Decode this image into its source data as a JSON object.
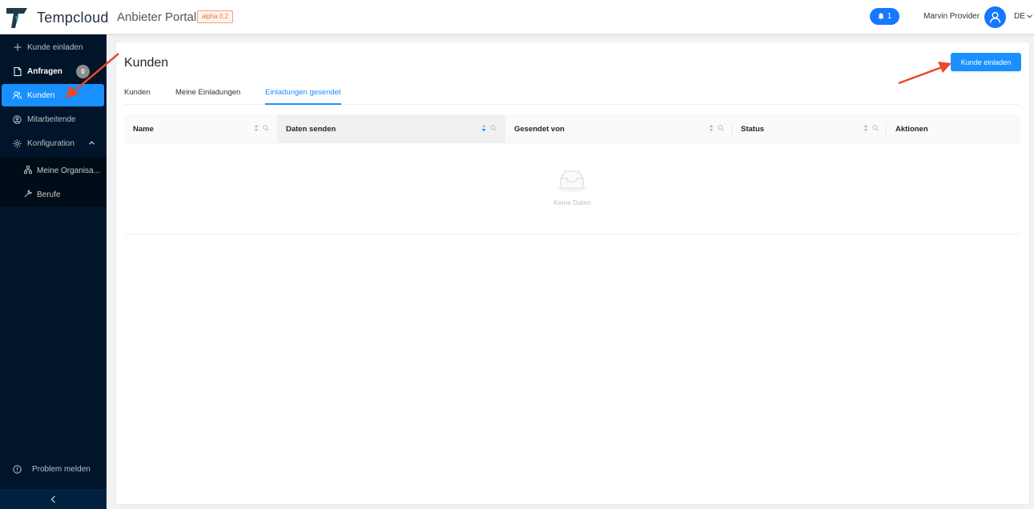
{
  "header": {
    "brand": "Tempcloud",
    "portal": "Anbieter Portal",
    "version_badge": "alpha 0.2",
    "notifications_count": "1",
    "user_name": "Marvin Provider",
    "language": "DE",
    "brand_color": "#1f3a4a",
    "accent_color": "#1677ff"
  },
  "sidebar": {
    "items": [
      {
        "label": "Kunde einladen",
        "icon": "plus-icon"
      },
      {
        "label": "Anfragen",
        "icon": "file-icon",
        "badge": "0"
      },
      {
        "label": "Kunden",
        "icon": "users-icon",
        "active": true
      },
      {
        "label": "Mitarbeitende",
        "icon": "team-icon"
      },
      {
        "label": "Konfiguration",
        "icon": "gear-icon",
        "expanded": true
      }
    ],
    "submenu": [
      {
        "label": "Meine Organisa...",
        "icon": "org-tree-icon"
      },
      {
        "label": "Berufe",
        "icon": "tool-icon"
      }
    ],
    "report_problem": "Problem melden",
    "collapse_icon": "chevron-left-icon"
  },
  "main": {
    "title": "Kunden",
    "invite_button": "Kunde einladen",
    "tabs": [
      {
        "label": "Kunden",
        "active": false
      },
      {
        "label": "Meine Einladungen",
        "active": false
      },
      {
        "label": "Einladungen gesendet",
        "active": true
      }
    ],
    "table": {
      "columns": [
        "Name",
        "Daten senden",
        "Gesendet von",
        "Status",
        "Aktionen"
      ],
      "empty_text": "Keine Daten"
    }
  }
}
